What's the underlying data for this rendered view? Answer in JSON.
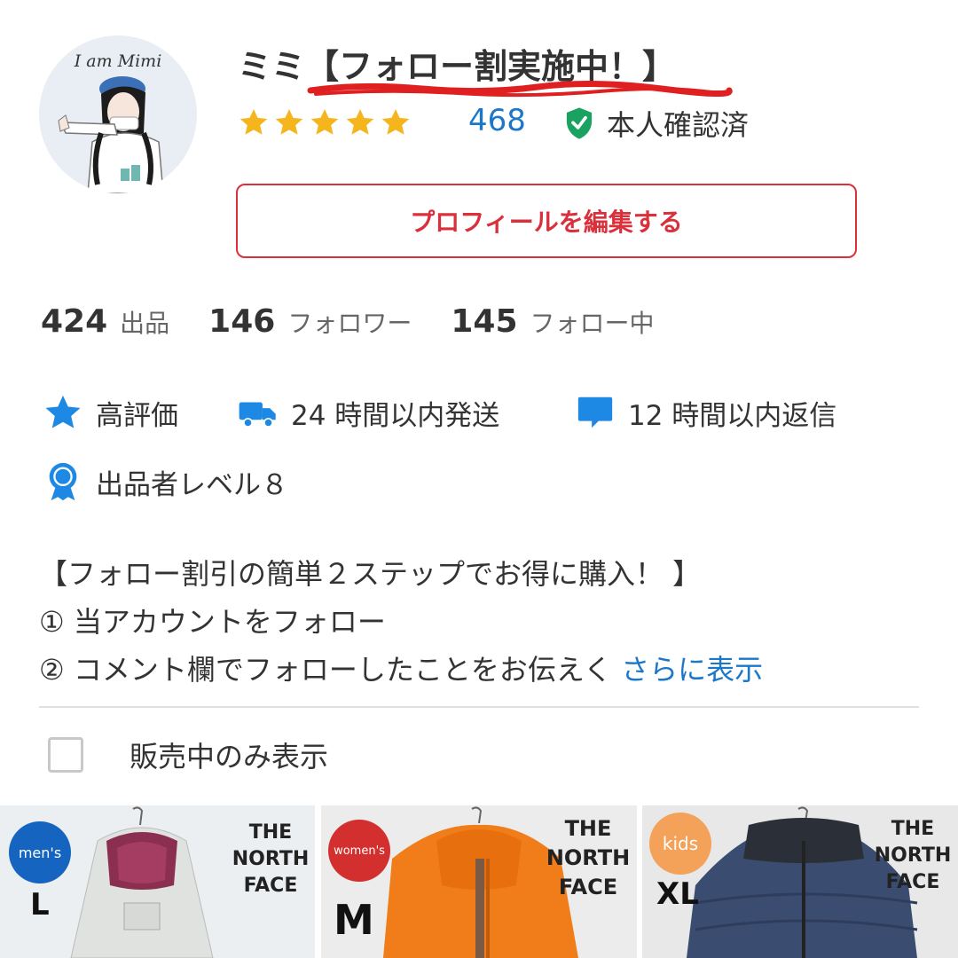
{
  "profile": {
    "avatar_caption": "I am Mimi",
    "name": "ミミ【フォロー割実施中！】",
    "rating_stars": 5,
    "rating_count": "468",
    "verified_label": "本人確認済",
    "edit_button_label": "プロフィールを編集する"
  },
  "stats": [
    {
      "value": "424",
      "label": "出品"
    },
    {
      "value": "146",
      "label": "フォロワー"
    },
    {
      "value": "145",
      "label": "フォロー中"
    }
  ],
  "badges": {
    "high_rating": "高評価",
    "shipping": "24 時間以内発送",
    "reply": "12 時間以内返信",
    "level": "出品者レベル８"
  },
  "description": {
    "line1": "【フォロー割引の簡単２ステップでお得に購入！ 】",
    "line2": "① 当アカウントをフォロー",
    "line3": "② コメント欄でフォローしたことをお伝えく",
    "more_link": "さらに表示"
  },
  "filter": {
    "label": "販売中のみ表示",
    "checked": false
  },
  "products": [
    {
      "badge": "men's",
      "badge_color": "#1565c0",
      "size": "L",
      "brand": [
        "THE",
        "NORTH",
        "FACE"
      ]
    },
    {
      "badge": "women's",
      "badge_color": "#d32f2f",
      "size": "M",
      "brand": [
        "THE",
        "NORTH",
        "FACE"
      ]
    },
    {
      "badge": "kids",
      "badge_color": "#f4a259",
      "size": "XL",
      "brand": [
        "THE",
        "NORTH",
        "FACE"
      ]
    }
  ],
  "colors": {
    "accent_red": "#d9303b",
    "link_blue": "#1a77c9",
    "star_yellow": "#f5b51c",
    "verified_green": "#1aa260",
    "badge_blue": "#1e88e5"
  }
}
